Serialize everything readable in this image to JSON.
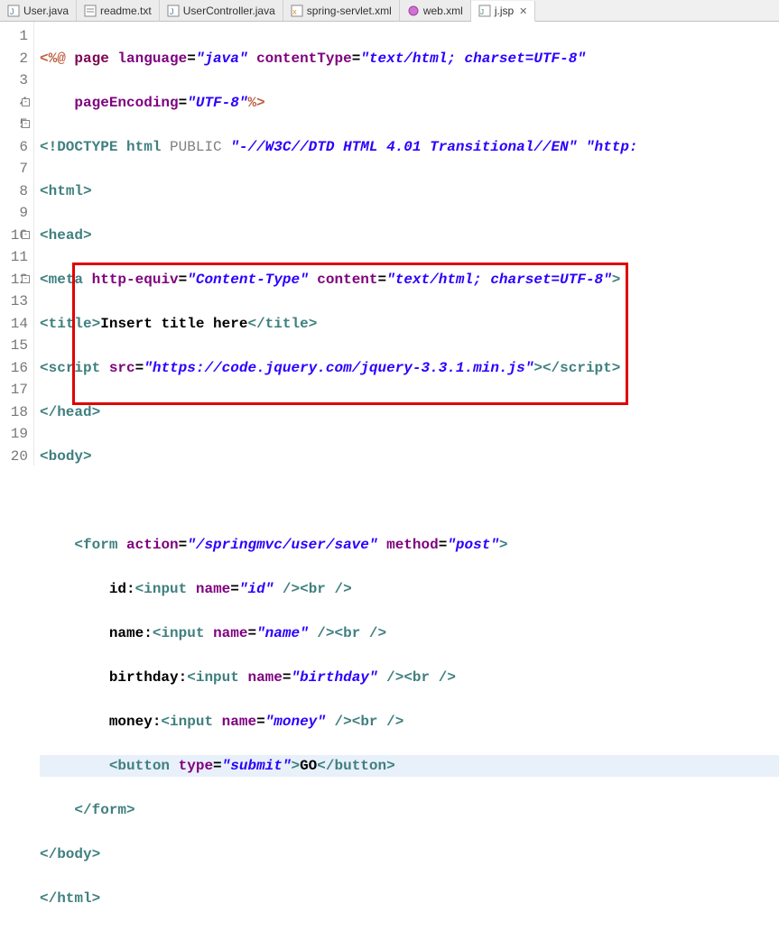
{
  "tabs": [
    {
      "label": "User.java",
      "icon": "java"
    },
    {
      "label": "readme.txt",
      "icon": "txt"
    },
    {
      "label": "UserController.java",
      "icon": "java"
    },
    {
      "label": "spring-servlet.xml",
      "icon": "xml"
    },
    {
      "label": "web.xml",
      "icon": "xml-web"
    },
    {
      "label": "j.jsp",
      "icon": "jsp",
      "active": true
    }
  ],
  "lines": {
    "l1": {
      "pct1": "<%@",
      "page": " page ",
      "lang_a": "language",
      "eq": "=",
      "lang_v": "\"java\"",
      "sp": " ",
      "ct_a": "contentType",
      "ct_v": "\"text/html; charset=UTF-8\""
    },
    "l2": {
      "indent": "    ",
      "pe_a": "pageEncoding",
      "eq": "=",
      "pe_v": "\"UTF-8\"",
      "pct2": "%>"
    },
    "l3": {
      "open": "<!",
      "doctype": "DOCTYPE html ",
      "pub": "PUBLIC ",
      "s1": "\"-//W3C//DTD HTML 4.01 Transitional//EN\"",
      "sp": " ",
      "s2": "\"http:"
    },
    "l4": {
      "o": "<",
      "t": "html",
      "c": ">"
    },
    "l5": {
      "o": "<",
      "t": "head",
      "c": ">"
    },
    "l6": {
      "o": "<",
      "t": "meta",
      "sp": " ",
      "a1": "http-equiv",
      "eq": "=",
      "v1": "\"Content-Type\"",
      "sp2": " ",
      "a2": "content",
      "v2": "\"text/html; charset=UTF-8\"",
      "c": ">"
    },
    "l7": {
      "o": "<",
      "t": "title",
      "c": ">",
      "txt": "Insert title here",
      "o2": "</",
      "t2": "title",
      "c2": ">"
    },
    "l8": {
      "o": "<",
      "t": "script",
      "sp": " ",
      "a": "src",
      "eq": "=",
      "v": "\"https://code.jquery.com/jquery-3.3.1.min.js\"",
      "c": ">",
      "o2": "</",
      "t2": "script",
      "c2": ">"
    },
    "l9": {
      "o": "</",
      "t": "head",
      "c": ">"
    },
    "l10": {
      "o": "<",
      "t": "body",
      "c": ">"
    },
    "l12": {
      "indent": "    ",
      "o": "<",
      "t": "form",
      "sp": " ",
      "a1": "action",
      "eq": "=",
      "v1": "\"/springmvc/user/save\"",
      "sp2": " ",
      "a2": "method",
      "v2": "\"post\"",
      "c": ">"
    },
    "l13": {
      "indent": "        ",
      "lbl": "id:",
      "o": "<",
      "t": "input",
      "sp": " ",
      "a": "name",
      "eq": "=",
      "v": "\"id\"",
      "sp2": " ",
      "c": "/>",
      "bo": "<",
      "bt": "br",
      "bsp": " ",
      "bc": "/>"
    },
    "l14": {
      "indent": "        ",
      "lbl": "name:",
      "o": "<",
      "t": "input",
      "sp": " ",
      "a": "name",
      "eq": "=",
      "v": "\"name\"",
      "sp2": " ",
      "c": "/>",
      "bo": "<",
      "bt": "br",
      "bsp": " ",
      "bc": "/>"
    },
    "l15": {
      "indent": "        ",
      "lbl": "birthday:",
      "o": "<",
      "t": "input",
      "sp": " ",
      "a": "name",
      "eq": "=",
      "v": "\"birthday\"",
      "sp2": " ",
      "c": "/>",
      "bo": "<",
      "bt": "br",
      "bsp": " ",
      "bc": "/>"
    },
    "l16": {
      "indent": "        ",
      "lbl": "money:",
      "o": "<",
      "t": "input",
      "sp": " ",
      "a": "name",
      "eq": "=",
      "v": "\"money\"",
      "sp2": " ",
      "c": "/>",
      "bo": "<",
      "bt": "br",
      "bsp": " ",
      "bc": "/>"
    },
    "l17": {
      "indent": "        ",
      "o": "<",
      "t": "button",
      "sp": " ",
      "a": "type",
      "eq": "=",
      "v": "\"submit\"",
      "c": ">",
      "txt": "GO",
      "o2": "</",
      "t2": "button",
      "c2": ">"
    },
    "l18": {
      "indent": "    ",
      "o": "</",
      "t": "form",
      "c": ">"
    },
    "l19": {
      "o": "</",
      "t": "body",
      "c": ">"
    },
    "l20": {
      "o": "</",
      "t": "html",
      "c": ">"
    }
  },
  "close_glyph": "✕"
}
